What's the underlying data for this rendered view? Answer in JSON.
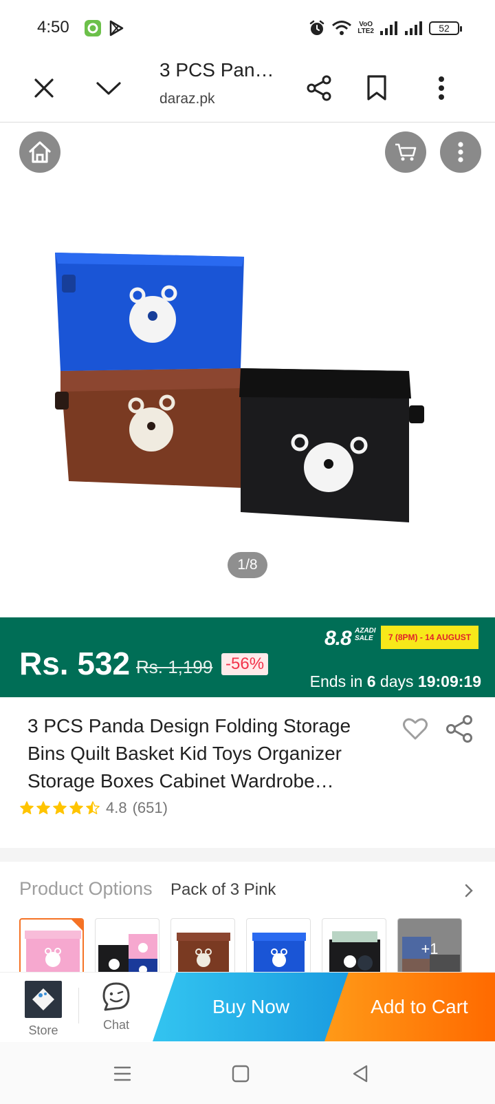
{
  "status_bar": {
    "time": "4:50",
    "battery": "52",
    "volte": [
      "VoO",
      "LTE2"
    ]
  },
  "tab_bar": {
    "title": "3 PCS Pan…",
    "url": "daraz.pk"
  },
  "gallery": {
    "page_indicator": "1/8"
  },
  "price": {
    "current": "Rs. 532",
    "original": "Rs. 1,199",
    "discount": "-56%",
    "sale_logo": "8.8",
    "sale_logo_small": [
      "AZADI",
      "SALE"
    ],
    "sale_date": "7 (8PM) - 14 AUGUST",
    "ends_prefix": "Ends in ",
    "ends_days": "6",
    "ends_days_label": " days ",
    "ends_time": "19:09:19"
  },
  "product": {
    "title": "3 PCS Panda Design Folding Storage Bins Quilt Basket Kid Toys Organizer Storage Boxes Cabinet Wardrobe…",
    "rating": "4.8",
    "reviews": "(651)",
    "stars_filled": 4.5
  },
  "options": {
    "label": "Product Options",
    "value": "Pack of 3 Pink",
    "more_count": "+1"
  },
  "action_bar": {
    "store_label": "Store",
    "chat_label": "Chat",
    "buy_now_label": "Buy Now",
    "add_to_cart_label": "Add to Cart"
  },
  "colors": {
    "banner_green": "#006e56",
    "discount_red": "#f2334b",
    "buy_now_blue": "#1a9ce0",
    "add_cart_orange": "#ff6a00",
    "star_yellow": "#ffc400"
  }
}
